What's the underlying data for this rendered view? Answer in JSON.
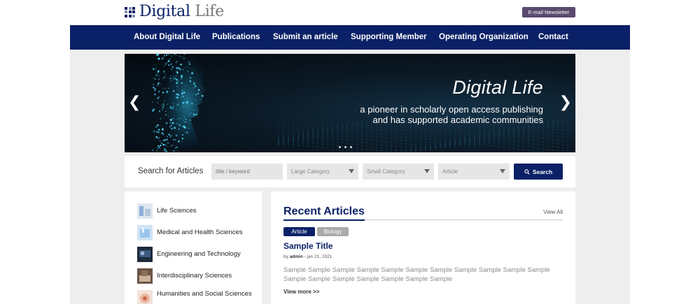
{
  "header": {
    "logo_primary": "Digital",
    "logo_secondary": "Life",
    "newsletter_label": "E-mail Newsletter"
  },
  "nav": {
    "items": [
      {
        "label": "About Digital Life"
      },
      {
        "label": "Publications"
      },
      {
        "label": "Submit an article"
      },
      {
        "label": "Supporting Member"
      },
      {
        "label": "Operating Organization"
      },
      {
        "label": "Contact"
      }
    ]
  },
  "hero": {
    "title": "Digital Life",
    "subtitle_line1": "a pioneer in scholarly open access publishing",
    "subtitle_line2": "and has supported academic communities",
    "prev_icon": "chevron-left-icon",
    "next_icon": "chevron-right-icon"
  },
  "search": {
    "label": "Search for Articles",
    "keyword_placeholder": "title / keyword",
    "large_category": "Large Category",
    "small_category": "Small Category",
    "type": "Article",
    "button_label": "Search"
  },
  "sidebar": {
    "categories": [
      {
        "label": "Life Sciences"
      },
      {
        "label": "Medical and Health Sciences"
      },
      {
        "label": "Engineering and Technology"
      },
      {
        "label": "Interdisciplinary Sciences"
      },
      {
        "label": "Humanities and Social Sciences"
      }
    ]
  },
  "recent": {
    "title": "Recent Articles",
    "view_all": "View All",
    "tags": [
      "Article",
      "Biology"
    ],
    "article_title": "Sample Title",
    "byline_prefix": "by",
    "author": "admin",
    "date": "- jan 21, 2021",
    "excerpt": "Sample Sample Sample Sample Sample Sample Sample Sample Sample Sample Sample Sample Sample Sample Sample Sample Sample Sample",
    "view_more": "View more >>"
  },
  "colors": {
    "brand_navy": "#0b2167",
    "newsletter": "#5b4a6e",
    "tag_gray": "#a9a9a9"
  }
}
